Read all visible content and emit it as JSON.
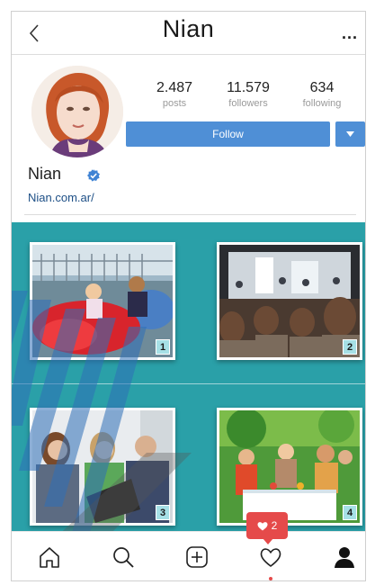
{
  "header": {
    "title": "Nian",
    "more": "...",
    "back_icon": "chevron-left-icon"
  },
  "profile": {
    "username": "Nian",
    "website": "Nian.com.ar/",
    "verified": true,
    "stats": [
      {
        "value": "2.487",
        "label": "posts"
      },
      {
        "value": "11.579",
        "label": "followers"
      },
      {
        "value": "634",
        "label": "following"
      }
    ],
    "follow_label": "Follow",
    "accent_color": "#4f8fd6"
  },
  "grid": {
    "background": "#2aa0a8",
    "photos": [
      {
        "badge": "1"
      },
      {
        "badge": "2"
      },
      {
        "badge": "3"
      },
      {
        "badge": "4"
      }
    ]
  },
  "nav": {
    "items": [
      "home-icon",
      "search-icon",
      "add-post-icon",
      "heart-icon",
      "profile-icon"
    ],
    "notification_count": "2",
    "notification_color": "#e54a4a"
  }
}
